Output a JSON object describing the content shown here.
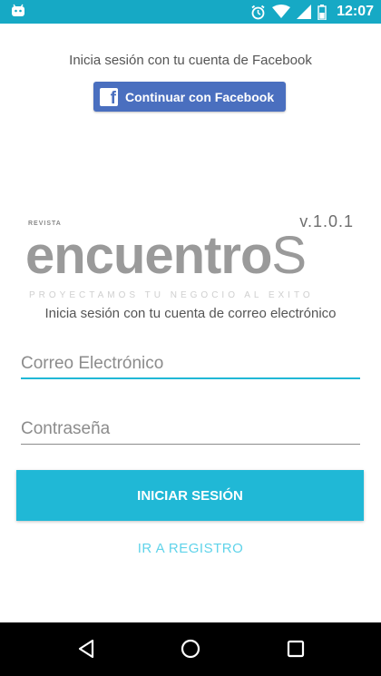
{
  "status_bar": {
    "time": "12:07",
    "icons": [
      "android-app-icon",
      "alarm-icon",
      "wifi-icon",
      "signal-icon",
      "battery-icon"
    ],
    "color": "#16a9c5"
  },
  "facebook": {
    "prompt": "Inicia sesión con tu cuenta de Facebook",
    "button_label": "Continuar con Facebook",
    "icon_glyph": "f",
    "color": "#4a6fbf"
  },
  "logo": {
    "small_text": "REVISTA",
    "word": "encuentro",
    "word_last": "S",
    "version": "v.1.0.1",
    "tagline": "PROYECTAMOS TU NEGOCIO AL EXITO"
  },
  "email_login": {
    "prompt": "Inicia sesión con tu cuenta de correo electrónico",
    "email_placeholder": "Correo Electrónico",
    "email_value": "",
    "password_placeholder": "Contraseña",
    "password_value": "",
    "login_label": "INICIAR SESIÓN",
    "register_label": "IR A REGISTRO",
    "accent_color": "#20b8d6"
  },
  "nav_bar": {
    "icons": [
      "back-icon",
      "home-icon",
      "recent-apps-icon"
    ]
  }
}
